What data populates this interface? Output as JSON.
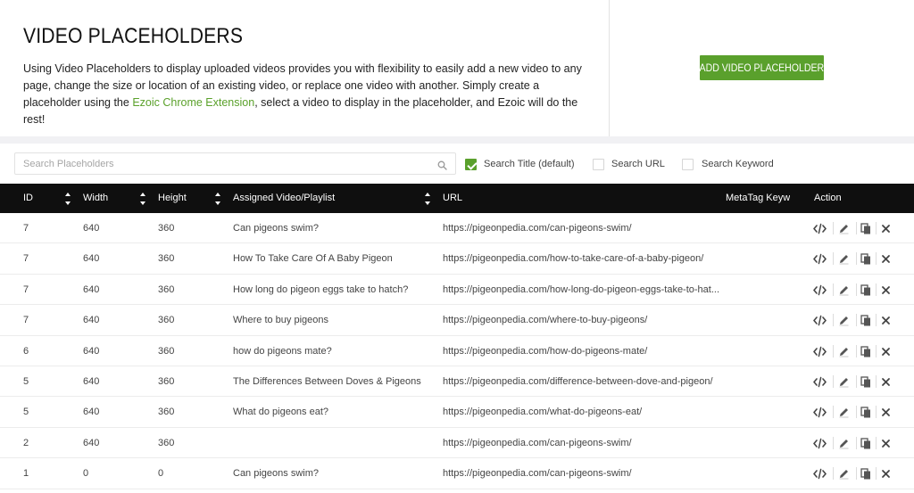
{
  "header": {
    "title": "VIDEO PLACEHOLDERS",
    "description_before_link": "Using Video Placeholders to display uploaded videos provides you with flexibility to easily add a new video to any page, change the size or location of an existing video, or replace one video with another. Simply create a placeholder using the ",
    "link_text": "Ezoic Chrome Extension",
    "description_after_link": ", select a video to display in the placeholder, and Ezoic will do the rest!",
    "add_button_label": "ADD VIDEO PLACEHOLDER"
  },
  "filters": {
    "search_placeholder": "Search Placeholders",
    "search_value": "",
    "options": [
      {
        "label": "Search Title (default)",
        "checked": true
      },
      {
        "label": "Search URL",
        "checked": false
      },
      {
        "label": "Search Keyword",
        "checked": false
      }
    ]
  },
  "table": {
    "columns": [
      "ID",
      "Width",
      "Height",
      "Assigned Video/Playlist",
      "URL",
      "MetaTag Keywords",
      "Action"
    ],
    "rows": [
      {
        "id": "7",
        "width": "640",
        "height": "360",
        "video": "Can pigeons swim?",
        "url": "https://pigeonpedia.com/can-pigeons-swim/"
      },
      {
        "id": "7",
        "width": "640",
        "height": "360",
        "video": "How To Take Care Of A Baby Pigeon",
        "url": "https://pigeonpedia.com/how-to-take-care-of-a-baby-pigeon/"
      },
      {
        "id": "7",
        "width": "640",
        "height": "360",
        "video": "How long do pigeon eggs take to hatch?",
        "url": "https://pigeonpedia.com/how-long-do-pigeon-eggs-take-to-hat..."
      },
      {
        "id": "7",
        "width": "640",
        "height": "360",
        "video": "Where to buy pigeons",
        "url": "https://pigeonpedia.com/where-to-buy-pigeons/"
      },
      {
        "id": "6",
        "width": "640",
        "height": "360",
        "video": "how do pigeons mate?",
        "url": "https://pigeonpedia.com/how-do-pigeons-mate/"
      },
      {
        "id": "5",
        "width": "640",
        "height": "360",
        "video": "The Differences Between Doves & Pigeons",
        "url": "https://pigeonpedia.com/difference-between-dove-and-pigeon/"
      },
      {
        "id": "5",
        "width": "640",
        "height": "360",
        "video": "What do pigeons eat?",
        "url": "https://pigeonpedia.com/what-do-pigeons-eat/"
      },
      {
        "id": "2",
        "width": "640",
        "height": "360",
        "video": "",
        "url": "https://pigeonpedia.com/can-pigeons-swim/"
      },
      {
        "id": "1",
        "width": "0",
        "height": "0",
        "video": "Can pigeons swim?",
        "url": "https://pigeonpedia.com/can-pigeons-swim/"
      }
    ],
    "row_actions": [
      "code-icon",
      "pencil-icon",
      "copy-icon",
      "close-icon"
    ]
  },
  "colors": {
    "accent": "#5aa02c",
    "table_header": "#0f0f0f"
  }
}
